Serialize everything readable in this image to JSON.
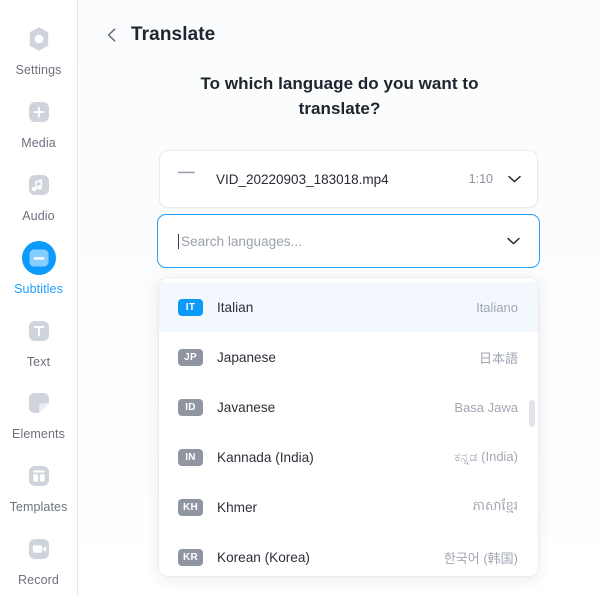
{
  "sidebar": {
    "items": [
      {
        "label": "Settings",
        "icon": "gear-icon",
        "active": false
      },
      {
        "label": "Media",
        "icon": "plus-square-icon",
        "active": false
      },
      {
        "label": "Audio",
        "icon": "music-note-icon",
        "active": false
      },
      {
        "label": "Subtitles",
        "icon": "subtitle-icon",
        "active": true
      },
      {
        "label": "Text",
        "icon": "text-t-icon",
        "active": false
      },
      {
        "label": "Elements",
        "icon": "shapes-icon",
        "active": false
      },
      {
        "label": "Templates",
        "icon": "layout-icon",
        "active": false
      },
      {
        "label": "Record",
        "icon": "video-camera-icon",
        "active": false
      }
    ],
    "active_color": "#1fa2ff",
    "inactive_color": "#6d7280"
  },
  "header": {
    "back_icon": "chevron-left-icon",
    "title": "Translate"
  },
  "main": {
    "question": "To which language do you want to translate?"
  },
  "file_card": {
    "thumbnail_icon": "image-placeholder-icon",
    "name": "VID_20220903_183018.mp4",
    "duration": "1:10",
    "chevron_icon": "chevron-down-icon"
  },
  "search": {
    "placeholder": "Search languages...",
    "value": "",
    "chevron_icon": "chevron-down-icon",
    "focus_color": "#1fa2ff"
  },
  "dropdown": {
    "languages": [
      {
        "code": "IT",
        "name": "Italian",
        "native": "Italiano",
        "selected": true
      },
      {
        "code": "JP",
        "name": "Japanese",
        "native": "日本語",
        "selected": false
      },
      {
        "code": "ID",
        "name": "Javanese",
        "native": "Basa Jawa",
        "selected": false
      },
      {
        "code": "IN",
        "name": "Kannada (India)",
        "native": "ಕನ್ನಡ (India)",
        "selected": false
      },
      {
        "code": "KH",
        "name": "Khmer",
        "native": "ភាសាខ្មែរ",
        "selected": false
      },
      {
        "code": "KR",
        "name": "Korean (Korea)",
        "native": "한국어 (韩国)",
        "selected": false
      }
    ],
    "selected_bg": "#f2f8fe",
    "badge_selected_color": "#0d9bfb",
    "badge_color": "#8f95a1"
  }
}
